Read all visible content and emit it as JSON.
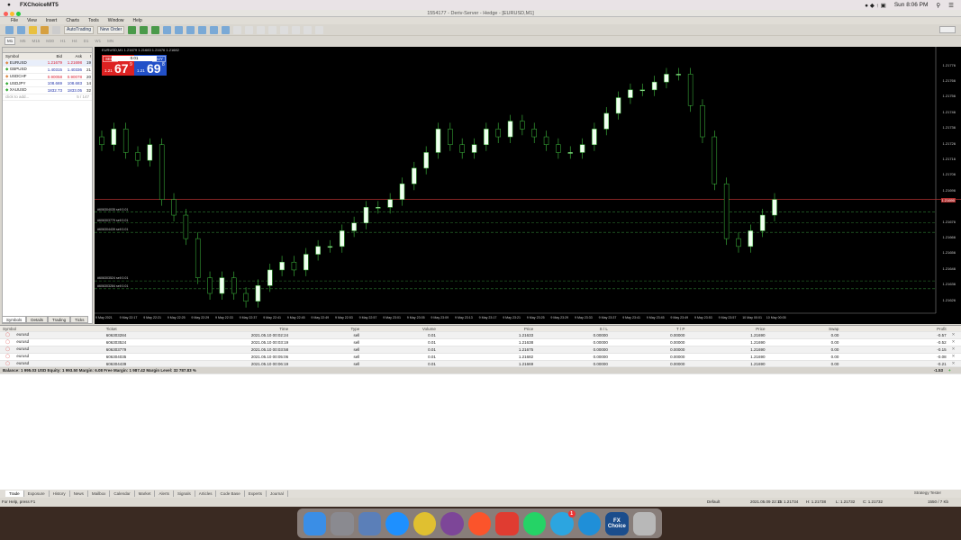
{
  "mac": {
    "app_name": "FXChoiceMT5",
    "clock": "Sun 8:06 PM"
  },
  "window": {
    "title": "1554177 - Deriv-Server - Hedge - [EURUSD,M1]"
  },
  "menu": [
    "File",
    "View",
    "Insert",
    "Charts",
    "Tools",
    "Window",
    "Help"
  ],
  "toolbar": {
    "autotrading": "AutoTrading",
    "new_order": "New Order"
  },
  "timeframes": [
    "M1",
    "M5",
    "M15",
    "M30",
    "H1",
    "H4",
    "D1",
    "W1",
    "MN"
  ],
  "market_watch": {
    "headers": [
      "Symbol",
      "Bid",
      "Ask",
      "!"
    ],
    "rows": [
      {
        "symbol": "EURUSD",
        "bid": "1.21679",
        "ask": "1.21698",
        "spread": "19"
      },
      {
        "symbol": "GBPUSD",
        "bid": "1.40315",
        "ask": "1.40336",
        "spread": "21"
      },
      {
        "symbol": "USDCHF",
        "bid": "0.90058",
        "ask": "0.90078",
        "spread": "20"
      },
      {
        "symbol": "USDJPY",
        "bid": "108.669",
        "ask": "108.683",
        "spread": "14"
      },
      {
        "symbol": "XAUUSD",
        "bid": "1832.73",
        "ask": "1833.05",
        "spread": "32"
      }
    ],
    "add_text": "click to add...",
    "count": "5 / 147",
    "tabs": [
      "Symbols",
      "Details",
      "Trading",
      "Ticks"
    ]
  },
  "chart": {
    "info": "EURUSD,M1  1.21679 1.21683 1.21676 1.21682",
    "sell_label": "SELL",
    "buy_label": "BUY",
    "volume": "0.01",
    "sell_prefix": "1.21",
    "sell_big": "67",
    "sell_sup": "9",
    "buy_prefix": "1.21",
    "buy_big": "69",
    "buy_sup": "8",
    "current_price": "1.21690",
    "price_labels": [
      "1.21776",
      "1.21766",
      "1.21756",
      "1.21746",
      "1.21736",
      "1.21726",
      "1.21716",
      "1.21706",
      "1.21696",
      "1.21676",
      "1.21666",
      "1.21656",
      "1.21646",
      "1.21636",
      "1.21626"
    ],
    "time_labels": [
      "9 May 2021",
      "9 May 22:17",
      "9 May 22:21",
      "9 May 22:25",
      "9 May 22:29",
      "9 May 22:33",
      "9 May 22:37",
      "9 May 22:41",
      "9 May 22:45",
      "9 May 22:49",
      "9 May 22:53",
      "9 May 22:57",
      "9 May 23:01",
      "9 May 23:05",
      "9 May 23:09",
      "9 May 23:13",
      "9 May 23:17",
      "9 May 23:21",
      "9 May 23:25",
      "9 May 23:29",
      "9 May 23:33",
      "9 May 23:37",
      "9 May 23:41",
      "9 May 23:45",
      "9 May 23:49",
      "9 May 23:53",
      "9 May 23:57",
      "10 May 00:01",
      "10 May 00:05"
    ],
    "order_lines": [
      {
        "label": "#606304035 sell 0.01",
        "price": 1.21682
      },
      {
        "label": "#606303779 sell 0.01",
        "price": 1.21675
      },
      {
        "label": "#606304439 sell 0.01",
        "price": 1.21669
      },
      {
        "label": "#606303524 sell 0.01",
        "price": 1.21638
      },
      {
        "label": "#606303284 sell 0.01",
        "price": 1.21633
      }
    ],
    "closes": [
      1.21725,
      1.21735,
      1.2172,
      1.21715,
      1.21725,
      1.2169,
      1.2168,
      1.21665,
      1.2164,
      1.2163,
      1.2164,
      1.2163,
      1.21625,
      1.21635,
      1.21645,
      1.2165,
      1.21645,
      1.21655,
      1.2166,
      1.2166,
      1.2167,
      1.21675,
      1.21685,
      1.21685,
      1.2169,
      1.217,
      1.2171,
      1.2172,
      1.21735,
      1.21725,
      1.2172,
      1.21725,
      1.21735,
      1.2173,
      1.2174,
      1.21735,
      1.2173,
      1.21725,
      1.2172,
      1.2172,
      1.21725,
      1.21735,
      1.21745,
      1.21755,
      1.2176,
      1.2176,
      1.21765,
      1.2177,
      1.2177,
      1.2175,
      1.2173,
      1.217,
      1.21665,
      1.2166,
      1.2167,
      1.2168,
      1.2169
    ],
    "colors": {
      "bull": "#f0fff0",
      "bear": "#000000",
      "wick": "#3fbf3f",
      "bid_line": "#b03030",
      "order_line": "#2e7d32"
    }
  },
  "trades": {
    "headers": [
      "Symbol",
      "Ticket",
      "Time",
      "Type",
      "Volume",
      "Price",
      "S / L",
      "T / P",
      "Price",
      "Swap",
      "Profit"
    ],
    "rows": [
      [
        "eurusd",
        "606303284",
        "2021.05.10 00:02:24",
        "sell",
        "0.01",
        "1.21633",
        "0.00000",
        "0.00000",
        "1.21690",
        "0.00",
        "-0.57"
      ],
      [
        "eurusd",
        "606303524",
        "2021.05.10 00:03:19",
        "sell",
        "0.01",
        "1.21638",
        "0.00000",
        "0.00000",
        "1.21690",
        "0.00",
        "-0.52"
      ],
      [
        "eurusd",
        "606303779",
        "2021.05.10 00:03:58",
        "sell",
        "0.01",
        "1.21675",
        "0.00000",
        "0.00000",
        "1.21690",
        "0.00",
        "-0.15"
      ],
      [
        "eurusd",
        "606304035",
        "2021.05.10 00:05:06",
        "sell",
        "0.01",
        "1.21682",
        "0.00000",
        "0.00000",
        "1.21690",
        "0.00",
        "-0.08"
      ],
      [
        "eurusd",
        "606304439",
        "2021.05.10 00:06:19",
        "sell",
        "0.01",
        "1.21669",
        "0.00000",
        "0.00000",
        "1.21690",
        "0.00",
        "-0.21"
      ]
    ],
    "balance": "Balance: 1 995.03 USD  Equity: 1 993.50  Margin: 6.08  Free Margin: 1 987.42  Margin Level: 32 787.83 %",
    "total_profit": "-1.53"
  },
  "bottom_tabs": [
    "Trade",
    "Exposure",
    "History",
    "News",
    "Mailbox",
    "Calendar",
    "Market",
    "Alerts",
    "Signals",
    "Articles",
    "Code Base",
    "Experts",
    "Journal"
  ],
  "strategy_tester": "Strategy Tester",
  "status": {
    "help": "For Help, press F1",
    "profile": "Default",
    "datetime": "2021.05.09 22:15",
    "open": "O: 1.21734",
    "high": "H: 1.21738",
    "low": "L: 1.21732",
    "close": "C: 1.21732",
    "traffic": "1550 / 7 Kb"
  },
  "dock": [
    {
      "name": "finder",
      "color": "#3a8ee6"
    },
    {
      "name": "launchpad",
      "color": "#8a8a90"
    },
    {
      "name": "preview",
      "color": "#5b7fb8"
    },
    {
      "name": "safari",
      "color": "#1e90ff"
    },
    {
      "name": "chrome",
      "color": "#e0c030"
    },
    {
      "name": "tor",
      "color": "#7d4698"
    },
    {
      "name": "brave",
      "color": "#fb542b"
    },
    {
      "name": "parallels",
      "color": "#e03c31"
    },
    {
      "name": "whatsapp",
      "color": "#25d366"
    },
    {
      "name": "telegram",
      "color": "#2ca5e0",
      "badge": "1"
    },
    {
      "name": "edge",
      "color": "#1f8fd8"
    },
    {
      "name": "fxchoice",
      "color": "#1b4d8c",
      "text": "FX Choice"
    },
    {
      "name": "trash",
      "color": "#b8b8b8"
    }
  ]
}
